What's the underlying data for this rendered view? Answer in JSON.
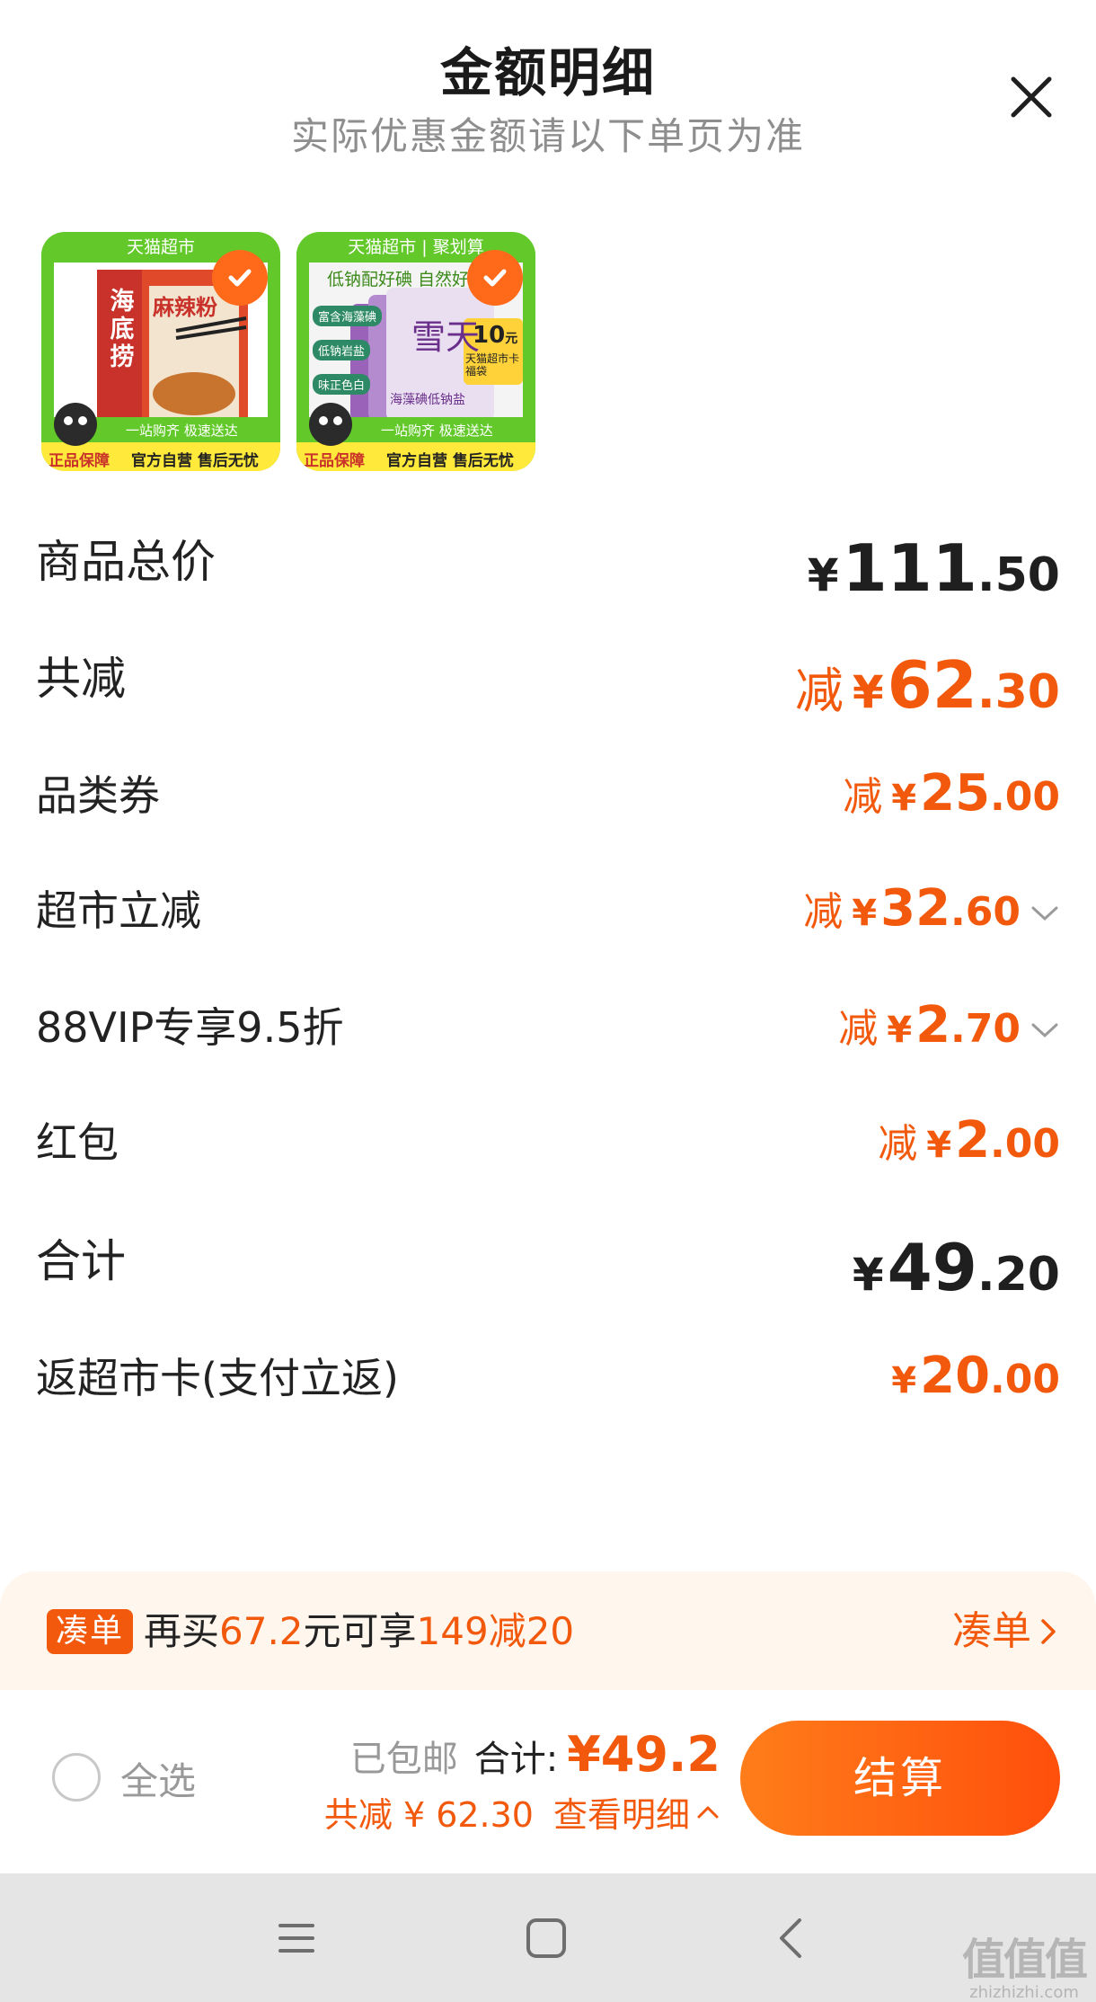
{
  "header": {
    "title": "金额明细",
    "subtitle": "实际优惠金额请以下单页为准"
  },
  "products": [
    {
      "banner": "天猫超市",
      "brand_vertical": [
        "海",
        "底",
        "捞"
      ],
      "pack_text": "麻辣粉",
      "badge_left": "正品保障",
      "strip_top": "一站购齐 极速送达",
      "strip_bottom": "官方自营 售后无忧",
      "checked": true
    },
    {
      "banner": "天猫超市 | 聚划算",
      "headline": "低钠配好碘 自然好",
      "chips": [
        "富含海藻碘",
        "低钠岩盐",
        "味正色白"
      ],
      "pack_text": "雪天",
      "card_num": "10",
      "card_unit": "元",
      "card_text": "天猫超市卡福袋",
      "pack_sub": "海藻碘低钠盐",
      "badge_left": "正品保障",
      "strip_top": "一站购齐 极速送达",
      "strip_bottom": "官方自营 售后无忧",
      "checked": true
    }
  ],
  "rows": [
    {
      "label": "商品总价",
      "prefix": "",
      "yen": "¥",
      "int": "111",
      "dec": ".50",
      "color": "black",
      "big": true,
      "chevron": false
    },
    {
      "label": "共减",
      "prefix": "减",
      "yen": "¥",
      "int": "62",
      "dec": ".30",
      "color": "orange",
      "big": true,
      "chevron": false
    },
    {
      "label": "品类券",
      "prefix": "减",
      "yen": "¥",
      "int": "25",
      "dec": ".00",
      "color": "orange",
      "big": false,
      "chevron": false
    },
    {
      "label": "超市立减",
      "prefix": "减",
      "yen": "¥",
      "int": "32",
      "dec": ".60",
      "color": "orange",
      "big": false,
      "chevron": true
    },
    {
      "label": "88VIP专享9.5折",
      "prefix": "减",
      "yen": "¥",
      "int": "2",
      "dec": ".70",
      "color": "orange",
      "big": false,
      "chevron": true
    },
    {
      "label": "红包",
      "prefix": "减",
      "yen": "¥",
      "int": "2",
      "dec": ".00",
      "color": "orange",
      "big": false,
      "chevron": false
    },
    {
      "label": "合计",
      "prefix": "",
      "yen": "¥",
      "int": "49",
      "dec": ".20",
      "color": "black",
      "big": true,
      "chevron": false
    },
    {
      "label": "返超市卡(支付立返)",
      "prefix": "",
      "yen": "¥",
      "int": "20",
      "dec": ".00",
      "color": "orange",
      "big": false,
      "chevron": false
    }
  ],
  "promo": {
    "badge": "凑单",
    "text_1": "再买",
    "amount": "67.2",
    "text_2": "元可享",
    "deal": "149减20",
    "link": "凑单"
  },
  "checkout": {
    "select_all": "全选",
    "shipping": "已包邮",
    "total_label": "合计:",
    "total_value": "¥49.2",
    "saved": "共减 ¥ 62.30",
    "detail_link": "查看明细",
    "pay_button": "结算"
  },
  "watermark": {
    "big": "值值值",
    "small": "zhizhizhi.com"
  },
  "colors": {
    "accent": "#f2590c",
    "text": "#1f1f1f",
    "muted": "#8e8e8e",
    "promo_bg": "#fff6ee"
  }
}
